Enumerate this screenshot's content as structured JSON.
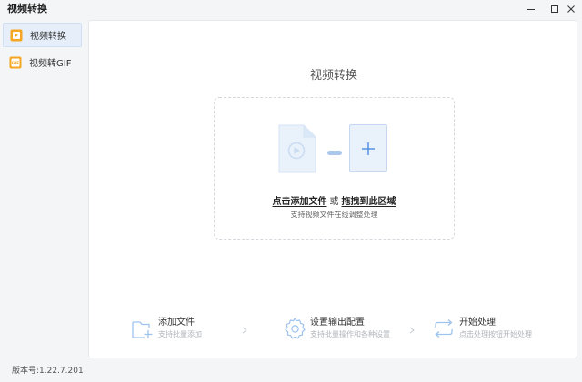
{
  "window": {
    "title": "视频转换"
  },
  "sidebar": {
    "items": [
      {
        "label": "视频转换",
        "icon": "video-convert-icon",
        "active": true
      },
      {
        "label": "视频转GIF",
        "icon": "gif-icon",
        "active": false
      }
    ]
  },
  "main": {
    "title": "视频转换",
    "dropzone": {
      "add_file_link": "点击添加文件",
      "or_text": "或",
      "drag_link": "拖拽到此区域",
      "hint": "支持视频文件在线调整处理",
      "icons": [
        "video-file-icon",
        "plus-icon"
      ]
    },
    "steps": [
      {
        "title": "添加文件",
        "subtitle": "支持批量添加",
        "icon": "add-file-icon"
      },
      {
        "title": "设置输出配置",
        "subtitle": "支持批量操作和各种设置",
        "icon": "settings-gear-icon"
      },
      {
        "title": "开始处理",
        "subtitle": "点击处理按钮开始处理",
        "icon": "start-process-icon"
      }
    ]
  },
  "footer": {
    "version": "版本号:1.22.7.201"
  },
  "colors": {
    "accent_light": "#e9f1fb",
    "accent_border": "#c5d8f2",
    "accent_icon": "#4a8de0",
    "orange_icon": "#f5a623",
    "step_icon": "#9ec3ee"
  }
}
